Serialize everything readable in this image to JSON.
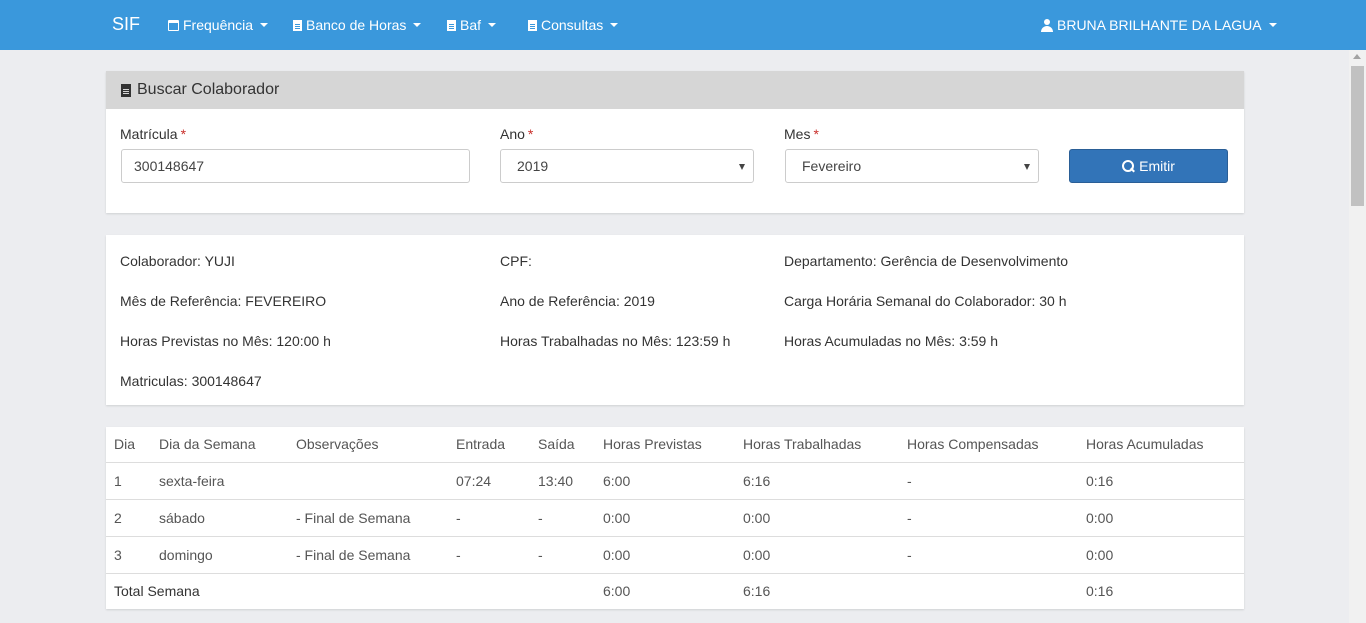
{
  "navbar": {
    "brand": "SIF",
    "items": [
      {
        "label": "Frequência",
        "icon": "calendar-icon"
      },
      {
        "label": "Banco de Horas",
        "icon": "file-icon"
      },
      {
        "label": "Baf",
        "icon": "file-icon"
      },
      {
        "label": "Consultas",
        "icon": "file-icon"
      }
    ],
    "user": "BRUNA BRILHANTE DA LAGUA"
  },
  "search_panel": {
    "title": "Buscar Colaborador",
    "matricula_label": "Matrícula",
    "matricula_value": "300148647",
    "ano_label": "Ano",
    "ano_value": "2019",
    "mes_label": "Mes",
    "mes_value": "Fevereiro",
    "required_mark": "*",
    "emitir_label": "Emitir"
  },
  "info_panel": {
    "colaborador": "Colaborador: YUJI",
    "cpf": "CPF:",
    "departamento": "Departamento: Gerência de Desenvolvimento",
    "mes_ref": "Mês de Referência: FEVEREIRO",
    "ano_ref": "Ano de Referência: 2019",
    "carga": "Carga Horária Semanal do Colaborador: 30 h",
    "horas_previstas": "Horas Previstas no Mês: 120:00 h",
    "horas_trabalhadas": "Horas Trabalhadas no Mês: 123:59 h",
    "horas_acumuladas": "Horas Acumuladas no Mês: 3:59 h",
    "matriculas": "Matriculas: 300148647"
  },
  "table": {
    "headers": [
      "Dia",
      "Dia da Semana",
      "Observações",
      "Entrada",
      "Saída",
      "Horas Previstas",
      "Horas Trabalhadas",
      "Horas Compensadas",
      "Horas Acumuladas"
    ],
    "rows": [
      [
        "1",
        "sexta-feira",
        "",
        "07:24",
        "13:40",
        "6:00",
        "6:16",
        "-",
        "0:16"
      ],
      [
        "2",
        "sábado",
        "- Final de Semana",
        "-",
        "-",
        "0:00",
        "0:00",
        "-",
        "0:00"
      ],
      [
        "3",
        "domingo",
        "- Final de Semana",
        "-",
        "-",
        "0:00",
        "0:00",
        "-",
        "0:00"
      ]
    ],
    "total": {
      "label": "Total Semana",
      "previstas": "6:00",
      "trabalhadas": "6:16",
      "acumuladas": "0:16"
    }
  }
}
